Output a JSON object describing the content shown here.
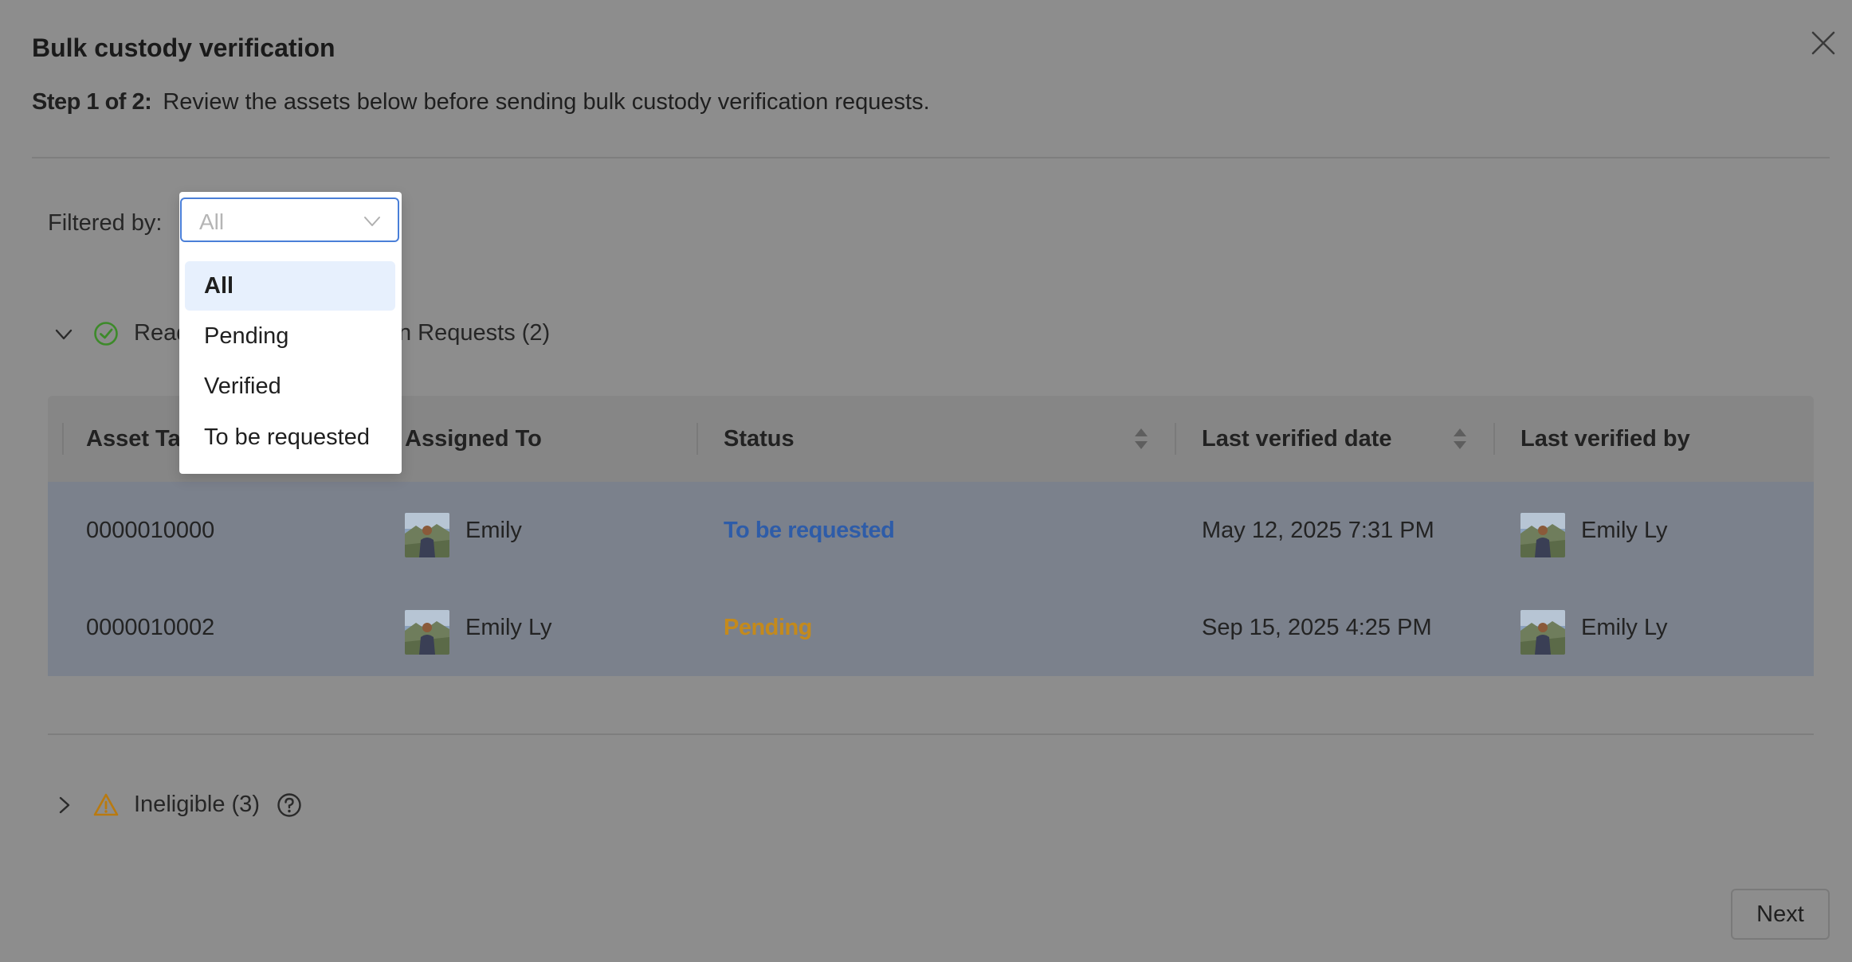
{
  "modal": {
    "title": "Bulk custody verification",
    "step_label": "Step 1 of 2:",
    "step_text": "Review the assets below before sending bulk custody verification requests."
  },
  "filter": {
    "label": "Filtered by:",
    "value": "All",
    "options": [
      {
        "label": "All",
        "selected": true
      },
      {
        "label": "Pending",
        "selected": false
      },
      {
        "label": "Verified",
        "selected": false
      },
      {
        "label": "To be requested",
        "selected": false
      }
    ]
  },
  "ready_section": {
    "title_visible_start": "Read",
    "title_visible_end": "n Requests (2)",
    "expanded": true
  },
  "table": {
    "columns": [
      {
        "label": "Asset Ta",
        "sortable": false
      },
      {
        "label": "Assigned To",
        "sortable": false
      },
      {
        "label": "Status",
        "sortable": true
      },
      {
        "label": "Last verified date",
        "sortable": true
      },
      {
        "label": "Last verified by",
        "sortable": false
      }
    ],
    "rows": [
      {
        "asset_tag": "0000010000",
        "assigned_to": "Emily",
        "status": "To be requested",
        "last_verified_date": "May 12, 2025 7:31 PM",
        "last_verified_by": "Emily Ly"
      },
      {
        "asset_tag": "0000010002",
        "assigned_to": "Emily Ly",
        "status": "Pending",
        "last_verified_date": "Sep 15, 2025 4:25 PM",
        "last_verified_by": "Emily Ly"
      }
    ]
  },
  "ineligible_section": {
    "title": "Ineligible (3)",
    "expanded": false
  },
  "footer": {
    "next_label": "Next"
  },
  "colors": {
    "overlay": "#8d8d8d",
    "status_to_be_requested": "#2e5ca8",
    "status_pending": "#c48a1c",
    "select_border": "#4a7fd8",
    "selected_option_bg": "#e7f0fd"
  }
}
